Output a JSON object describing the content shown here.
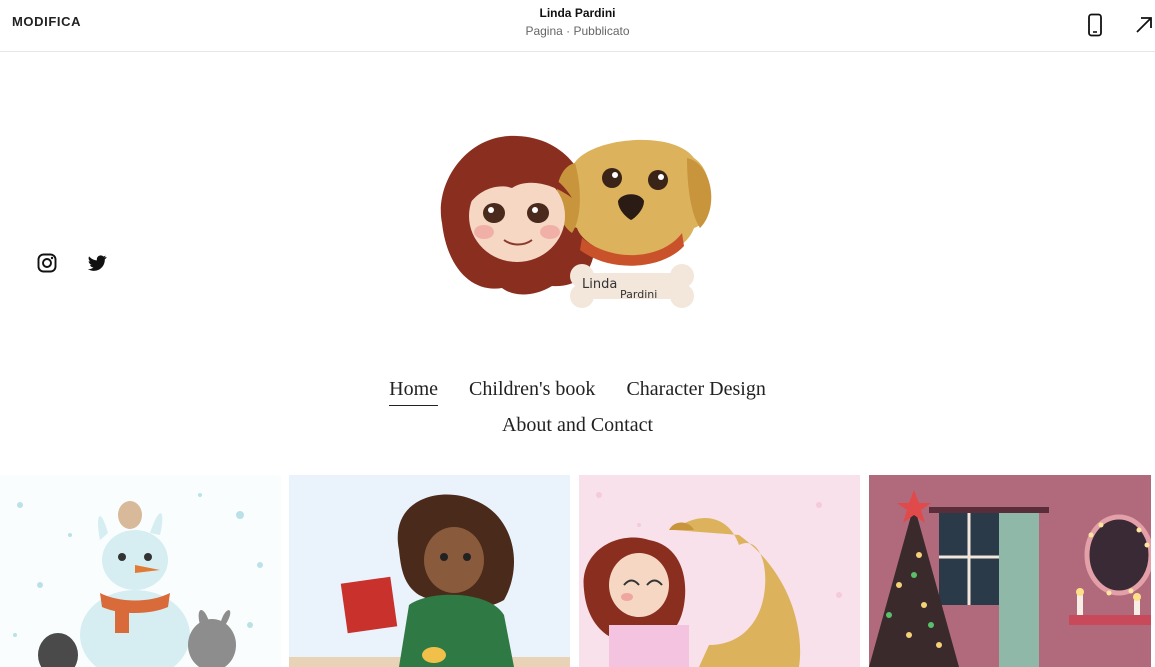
{
  "editor_bar": {
    "edit_label": "MODIFICA",
    "site_title": "Linda Pardini",
    "page_status": "Pagina · Pubblicato",
    "mobile_icon": "mobile-phone-icon",
    "open_icon": "arrow-up-right-icon"
  },
  "social": {
    "instagram_icon": "instagram-icon",
    "twitter_icon": "twitter-icon"
  },
  "logo": {
    "bone_text_1": "Linda",
    "bone_text_2": "Pardini"
  },
  "nav": {
    "items": [
      {
        "label": "Home",
        "active": true
      },
      {
        "label": "Children's book",
        "active": false
      },
      {
        "label": "Character Design",
        "active": false
      },
      {
        "label": "About and Contact",
        "active": false
      }
    ]
  },
  "gallery": {
    "tiles": [
      {
        "subject": "snowman with bunnies"
      },
      {
        "subject": "girl with red book"
      },
      {
        "subject": "girl hugging dog"
      },
      {
        "subject": "christmas tree room"
      }
    ]
  },
  "colors": {
    "text": "#222222",
    "status_gray": "#666666",
    "divider": "#e6e6e6"
  }
}
